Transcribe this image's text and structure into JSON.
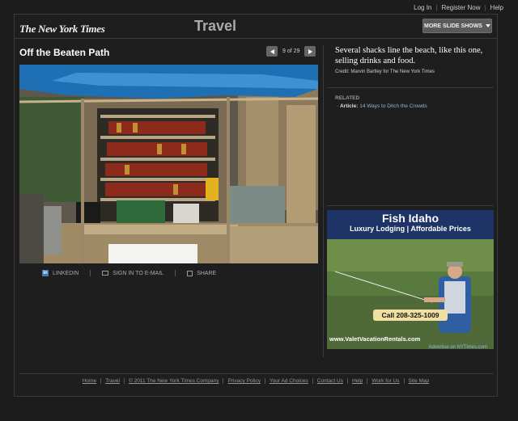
{
  "topnav": {
    "login": "Log In",
    "register": "Register Now",
    "help": "Help"
  },
  "masthead": {
    "logo": "The New York Times",
    "section": "Travel",
    "more_slideshows": "MORE SLIDE SHOWS"
  },
  "slideshow": {
    "title": "Off the Beaten Path",
    "counter": "9 of 29"
  },
  "share": {
    "linkedin": "LINKEDIN",
    "email": "SIGN IN TO E-MAIL",
    "share": "SHARE",
    "linkedin_glyph": "in"
  },
  "caption": {
    "text": "Several shacks line the beach, like this one, selling drinks and food.",
    "credit": "Credit: Marvin Bartley for The New York Times"
  },
  "related": {
    "label": "RELATED",
    "item_type": "Article:",
    "item_link": "14 Ways to Ditch the Crowds"
  },
  "ad": {
    "title": "Fish Idaho",
    "subtitle": "Luxury Lodging | Affordable Prices",
    "phone": "Call 208-325-1009",
    "url": "www.ValetVacationRentals.com",
    "advertise": "Advertise on NYTimes.com"
  },
  "footer": [
    "Home",
    "Travel",
    "© 2011 The New York Times Company",
    "Privacy Policy",
    "Your Ad Choices",
    "Contact Us",
    "Help",
    "Work for Us",
    "Site Map"
  ]
}
